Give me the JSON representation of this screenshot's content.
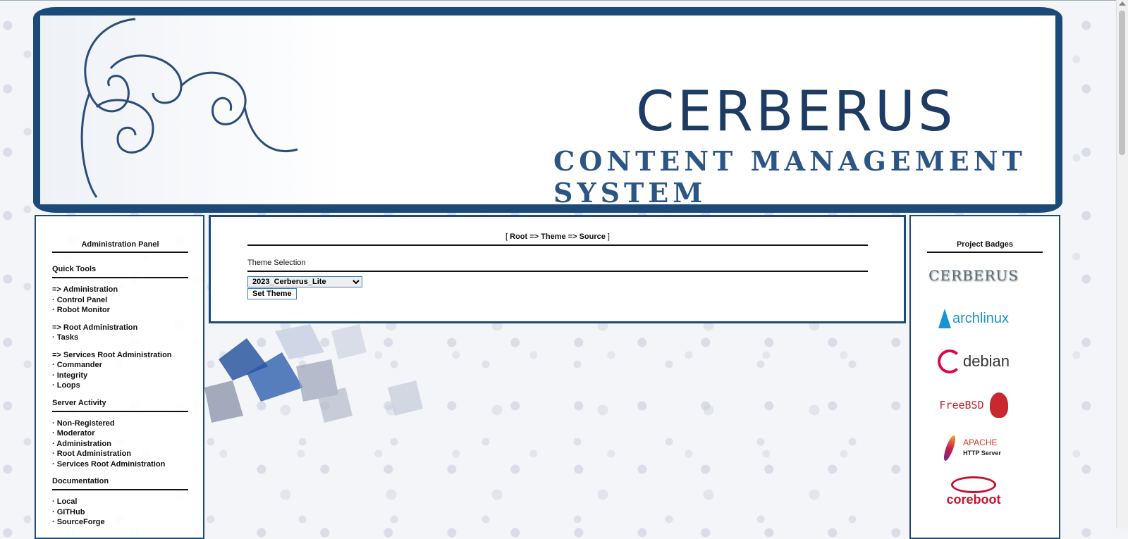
{
  "banner": {
    "title": "CERBERUS",
    "subtitle": "CONTENT MANAGEMENT SYSTEM"
  },
  "left_panel": {
    "title": "Administration Panel",
    "quick_tools": {
      "heading": "Quick Tools",
      "administration": {
        "header": "=> Administration",
        "items": [
          "· Control Panel",
          "· Robot Monitor"
        ]
      },
      "root_administration": {
        "header": "=> Root Administration",
        "items": [
          "· Tasks"
        ]
      },
      "services_root_administration": {
        "header": "=> Services Root Administration",
        "items": [
          "· Commander",
          "· Integrity",
          "· Loops"
        ]
      }
    },
    "server_activity": {
      "heading": "Server Activity",
      "items": [
        "· Non-Registered",
        "· Moderator",
        "· Administration",
        "· Root Administration",
        "· Services Root Administration"
      ]
    },
    "documentation": {
      "heading": "Documentation",
      "items": [
        "· Local",
        "· GITHub",
        "· SourceForge"
      ]
    }
  },
  "center_panel": {
    "breadcrumb": {
      "open": "[",
      "path": "Root => Theme => Source",
      "close": "]"
    },
    "theme_selection_label": "Theme Selection",
    "theme_select_value": "2023_Cerberus_Lite",
    "set_theme_button": "Set Theme"
  },
  "right_panel": {
    "title": "Project Badges",
    "badges": {
      "cerberus": "CERBERUS",
      "archlinux": "archlinux",
      "debian": "debian",
      "freebsd": "FreeBSD",
      "apache_line1": "APACHE",
      "apache_line2": "HTTP Server",
      "coreboot": "coreboot"
    }
  },
  "colors": {
    "frame": "#1c4a78",
    "title": "#1d3b63"
  }
}
